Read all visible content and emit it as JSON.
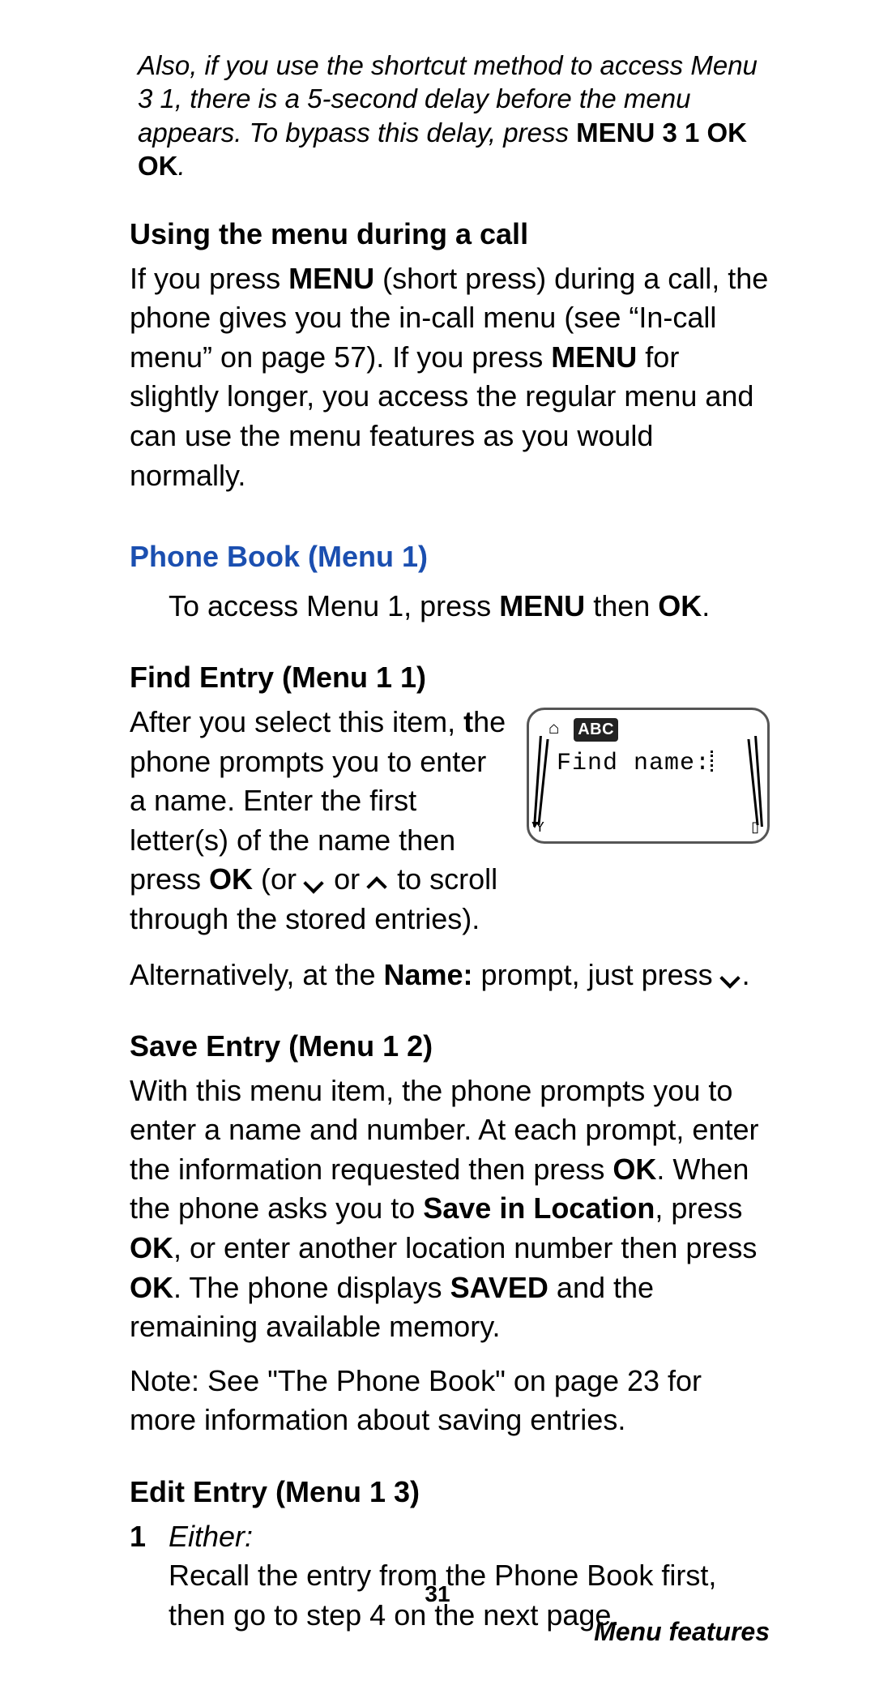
{
  "note": {
    "text": "Also, if you use the shortcut method to access Menu 3 1, there is a 5-second delay before the menu appears. To bypass this delay, press ",
    "bold": "MENU 3 1 OK OK",
    "dot": "."
  },
  "s1": {
    "h": "Using the menu during a call",
    "p1a": "If you press ",
    "p1b": "MENU",
    "p1c": " (short press) during a call, the phone gives you the in-call menu (see “In-call menu” on page 57). If you press ",
    "p1d": "MENU",
    "p1e": " for slightly longer, you access the regular menu and can use the menu features as you would normally."
  },
  "pb": {
    "h": "Phone Book (Menu 1)",
    "p1": "To access Menu 1, press ",
    "b1": "MENU",
    "p2": " then ",
    "b2": "OK",
    "p3": "."
  },
  "find": {
    "h": "Find Entry (Menu 1 1)",
    "p1": "After you select this item, ",
    "t": "t",
    "p1b": "he phone prompts you to enter a name. Enter the first letter(s) of the name then press ",
    "b1": "OK",
    "p2a": " (or ",
    "p2b": " or ",
    "p2c": " to scroll through the stored entries).",
    "alt1": "Alternatively, at the ",
    "altB": "Name:",
    "alt2": " prompt, just press ",
    "alt3": "."
  },
  "screen": {
    "abc": "ABC",
    "text": "Find name:"
  },
  "save": {
    "h": "Save Entry (Menu 1 2)",
    "p1": "With this menu item, the phone prompts you to enter a name and number. At each prompt, enter the information requested then press ",
    "b1": "OK",
    "p2": ". When the phone asks you to ",
    "b2": "Save in Location",
    "p3": ", press ",
    "b3": "OK",
    "p4": ", or enter another location number then press ",
    "b4": "OK",
    "p5": ". The phone displays ",
    "b5": "SAVED",
    "p6": " and the remaining available memory.",
    "note": "Note: See \"The Phone Book\" on page 23 for more information about saving entries."
  },
  "edit": {
    "h": "Edit Entry (Menu 1 3)",
    "n": "1",
    "either": "Either:",
    "body": "Recall the entry from the Phone Book first, then go to step 4 on the next page."
  },
  "footer": {
    "page": "31",
    "title": "Menu features"
  }
}
